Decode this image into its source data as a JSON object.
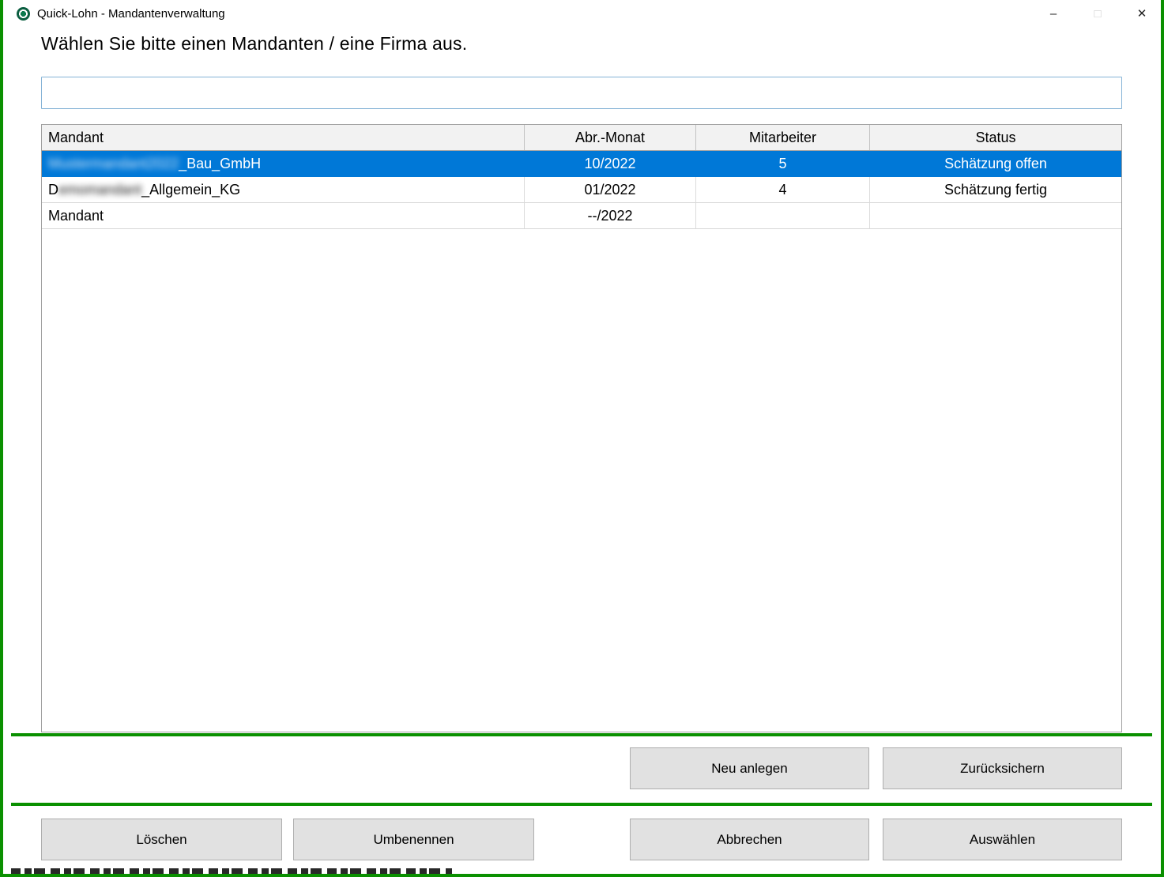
{
  "window": {
    "title": "Quick-Lohn - Mandantenverwaltung",
    "controls": {
      "minimize": "–",
      "maximize": "□",
      "close": "✕"
    }
  },
  "heading": "Wählen Sie bitte einen Mandanten / eine Firma aus.",
  "filter": {
    "value": "",
    "placeholder": ""
  },
  "table": {
    "columns": [
      "Mandant",
      "Abr.-Monat",
      "Mitarbeiter",
      "Status"
    ],
    "rows": [
      {
        "name_redacted": "Mustermandant2022",
        "name_visible": "_Bau_GmbH",
        "abr_monat": "10/2022",
        "mitarbeiter": "5",
        "status": "Schätzung offen",
        "selected": true
      },
      {
        "name_prefix": "D",
        "name_redacted": "emomandant",
        "name_visible": "_Allgemein_KG",
        "abr_monat": "01/2022",
        "mitarbeiter": "4",
        "status": "Schätzung fertig",
        "selected": false
      },
      {
        "name": "Mandant",
        "abr_monat": "--/2022",
        "mitarbeiter": "",
        "status": "",
        "selected": false
      }
    ]
  },
  "buttons": {
    "neu_anlegen": "Neu anlegen",
    "zuruecksichern": "Zurücksichern",
    "loeschen": "Löschen",
    "umbenennen": "Umbenennen",
    "abbrechen": "Abbrechen",
    "auswaehlen": "Auswählen"
  },
  "colors": {
    "selection_blue": "#0078d7",
    "frame_green": "#0a9000",
    "button_bg": "#e1e1e1",
    "header_bg": "#f2f2f2"
  }
}
